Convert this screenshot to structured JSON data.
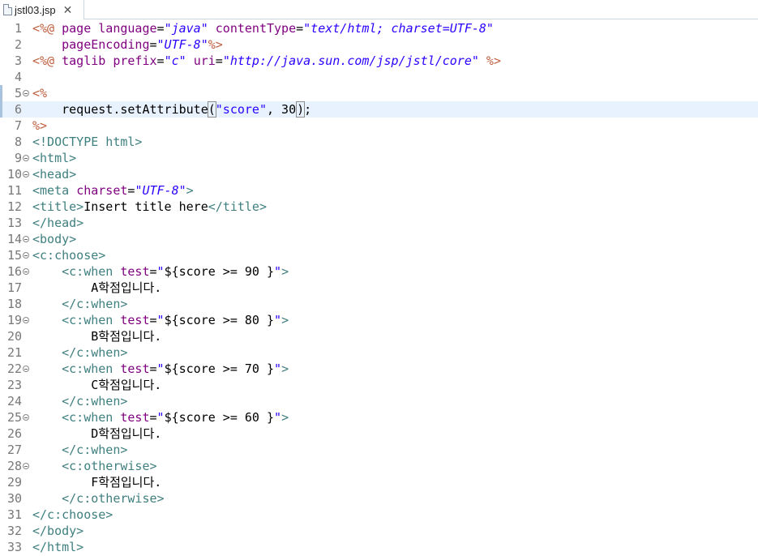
{
  "tab": {
    "title": "jstl03.jsp",
    "close": "✕",
    "icon": "jsp-file-icon"
  },
  "colors": {
    "directive": "#bf5f3f",
    "attribute": "#7f007f",
    "value": "#2a00ff",
    "tag": "#3f7f7f",
    "text": "#000000",
    "current_line": "#e8f2fe"
  },
  "editor": {
    "current_line": 6,
    "lines": [
      {
        "n": "1",
        "fold": false,
        "tokens": [
          [
            "directive",
            "<%@ "
          ],
          [
            "attr",
            "page "
          ],
          [
            "attr",
            "language"
          ],
          [
            "plain",
            "="
          ],
          [
            "val",
            "\"java\""
          ],
          [
            "plain",
            " "
          ],
          [
            "attr",
            "contentType"
          ],
          [
            "plain",
            "="
          ],
          [
            "val",
            "\"text/html; charset=UTF-8\""
          ]
        ]
      },
      {
        "n": "2",
        "fold": false,
        "tokens": [
          [
            "plain",
            "    "
          ],
          [
            "attr",
            "pageEncoding"
          ],
          [
            "plain",
            "="
          ],
          [
            "val",
            "\"UTF-8\""
          ],
          [
            "directive",
            "%>"
          ]
        ]
      },
      {
        "n": "3",
        "fold": false,
        "tokens": [
          [
            "directive",
            "<%@ "
          ],
          [
            "attr",
            "taglib "
          ],
          [
            "attr",
            "prefix"
          ],
          [
            "plain",
            "="
          ],
          [
            "val",
            "\"c\""
          ],
          [
            "plain",
            " "
          ],
          [
            "attr",
            "uri"
          ],
          [
            "plain",
            "="
          ],
          [
            "val",
            "\"http://java.sun.com/jsp/jstl/core\""
          ],
          [
            "plain",
            " "
          ],
          [
            "directive",
            "%>"
          ]
        ]
      },
      {
        "n": "4",
        "fold": false,
        "tokens": []
      },
      {
        "n": "5",
        "fold": true,
        "tokens": [
          [
            "directive",
            "<%"
          ]
        ]
      },
      {
        "n": "6",
        "fold": false,
        "tokens": [
          [
            "plain",
            "    request.setAttribute"
          ],
          [
            "caretbox",
            "("
          ],
          [
            "val-plain",
            "\"score\""
          ],
          [
            "plain",
            ", 30"
          ],
          [
            "caret",
            ""
          ],
          [
            "caretbox",
            ")"
          ],
          [
            "plain",
            ";"
          ]
        ]
      },
      {
        "n": "7",
        "fold": false,
        "tokens": [
          [
            "directive",
            "%>"
          ]
        ]
      },
      {
        "n": "8",
        "fold": false,
        "tokens": [
          [
            "tag",
            "<!DOCTYPE html>"
          ]
        ]
      },
      {
        "n": "9",
        "fold": true,
        "tokens": [
          [
            "tag",
            "<html>"
          ]
        ]
      },
      {
        "n": "10",
        "fold": true,
        "tokens": [
          [
            "tag",
            "<head>"
          ]
        ]
      },
      {
        "n": "11",
        "fold": false,
        "tokens": [
          [
            "tag",
            "<meta "
          ],
          [
            "attr",
            "charset"
          ],
          [
            "plain",
            "="
          ],
          [
            "val",
            "\"UTF-8\""
          ],
          [
            "tag",
            ">"
          ]
        ]
      },
      {
        "n": "12",
        "fold": false,
        "tokens": [
          [
            "tag",
            "<title>"
          ],
          [
            "plain",
            "Insert title here"
          ],
          [
            "tag",
            "</title>"
          ]
        ]
      },
      {
        "n": "13",
        "fold": false,
        "tokens": [
          [
            "tag",
            "</head>"
          ]
        ]
      },
      {
        "n": "14",
        "fold": true,
        "tokens": [
          [
            "tag",
            "<body>"
          ]
        ]
      },
      {
        "n": "15",
        "fold": true,
        "tokens": [
          [
            "tag",
            "<c:choose>"
          ]
        ]
      },
      {
        "n": "16",
        "fold": true,
        "tokens": [
          [
            "plain",
            "    "
          ],
          [
            "tag",
            "<c:when "
          ],
          [
            "attr",
            "test"
          ],
          [
            "plain",
            "="
          ],
          [
            "val-plain",
            "\""
          ],
          [
            "plain",
            "${score >= 90 }"
          ],
          [
            "val-plain",
            "\""
          ],
          [
            "tag",
            ">"
          ]
        ]
      },
      {
        "n": "17",
        "fold": false,
        "tokens": [
          [
            "plain",
            "        A학점입니다."
          ]
        ]
      },
      {
        "n": "18",
        "fold": false,
        "tokens": [
          [
            "plain",
            "    "
          ],
          [
            "tag",
            "</c:when>"
          ]
        ]
      },
      {
        "n": "19",
        "fold": true,
        "tokens": [
          [
            "plain",
            "    "
          ],
          [
            "tag",
            "<c:when "
          ],
          [
            "attr",
            "test"
          ],
          [
            "plain",
            "="
          ],
          [
            "val-plain",
            "\""
          ],
          [
            "plain",
            "${score >= 80 }"
          ],
          [
            "val-plain",
            "\""
          ],
          [
            "tag",
            ">"
          ]
        ]
      },
      {
        "n": "20",
        "fold": false,
        "tokens": [
          [
            "plain",
            "        B학점입니다."
          ]
        ]
      },
      {
        "n": "21",
        "fold": false,
        "tokens": [
          [
            "plain",
            "    "
          ],
          [
            "tag",
            "</c:when>"
          ]
        ]
      },
      {
        "n": "22",
        "fold": true,
        "tokens": [
          [
            "plain",
            "    "
          ],
          [
            "tag",
            "<c:when "
          ],
          [
            "attr",
            "test"
          ],
          [
            "plain",
            "="
          ],
          [
            "val-plain",
            "\""
          ],
          [
            "plain",
            "${score >= 70 }"
          ],
          [
            "val-plain",
            "\""
          ],
          [
            "tag",
            ">"
          ]
        ]
      },
      {
        "n": "23",
        "fold": false,
        "tokens": [
          [
            "plain",
            "        C학점입니다."
          ]
        ]
      },
      {
        "n": "24",
        "fold": false,
        "tokens": [
          [
            "plain",
            "    "
          ],
          [
            "tag",
            "</c:when>"
          ]
        ]
      },
      {
        "n": "25",
        "fold": true,
        "tokens": [
          [
            "plain",
            "    "
          ],
          [
            "tag",
            "<c:when "
          ],
          [
            "attr",
            "test"
          ],
          [
            "plain",
            "="
          ],
          [
            "val-plain",
            "\""
          ],
          [
            "plain",
            "${score >= 60 }"
          ],
          [
            "val-plain",
            "\""
          ],
          [
            "tag",
            ">"
          ]
        ]
      },
      {
        "n": "26",
        "fold": false,
        "tokens": [
          [
            "plain",
            "        D학점입니다."
          ]
        ]
      },
      {
        "n": "27",
        "fold": false,
        "tokens": [
          [
            "plain",
            "    "
          ],
          [
            "tag",
            "</c:when>"
          ]
        ]
      },
      {
        "n": "28",
        "fold": true,
        "tokens": [
          [
            "plain",
            "    "
          ],
          [
            "tag",
            "<c:otherwise>"
          ]
        ]
      },
      {
        "n": "29",
        "fold": false,
        "tokens": [
          [
            "plain",
            "        F학점입니다."
          ]
        ]
      },
      {
        "n": "30",
        "fold": false,
        "tokens": [
          [
            "plain",
            "    "
          ],
          [
            "tag",
            "</c:otherwise>"
          ]
        ]
      },
      {
        "n": "31",
        "fold": false,
        "tokens": [
          [
            "tag",
            "</c:choose>"
          ]
        ]
      },
      {
        "n": "32",
        "fold": false,
        "tokens": [
          [
            "tag",
            "</body>"
          ]
        ]
      },
      {
        "n": "33",
        "fold": false,
        "tokens": [
          [
            "tag",
            "</html>"
          ]
        ]
      }
    ]
  }
}
